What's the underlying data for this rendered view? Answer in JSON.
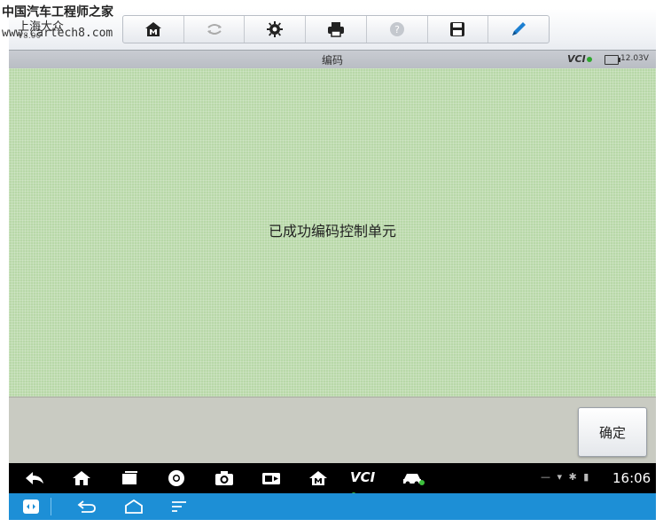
{
  "watermark": {
    "site_name": "中国汽车工程师之家",
    "url": "www.cartech8.com"
  },
  "toolbar": {
    "brand_name": "上海大众",
    "brand_version": "V8.00",
    "buttons": [
      {
        "icon": "home-icon"
      },
      {
        "icon": "vehicle-swap-icon"
      },
      {
        "icon": "gear-icon"
      },
      {
        "icon": "printer-icon"
      },
      {
        "icon": "help-icon"
      },
      {
        "icon": "save-icon"
      },
      {
        "icon": "pen-icon"
      }
    ]
  },
  "titlebar": {
    "title": "编码",
    "vci_label": "VCI",
    "voltage": "12.03V"
  },
  "content": {
    "message": "已成功编码控制单元",
    "background_color": "#b8d8a8"
  },
  "actions": {
    "confirm_label": "确定"
  },
  "statusbar": {
    "icons": [
      "back-icon",
      "home-icon",
      "recent-apps-icon",
      "chrome-icon",
      "camera-icon",
      "screen-capture-icon",
      "maxisys-icon",
      "vci-icon",
      "car-icon"
    ],
    "vci_text": "VCI",
    "time": "16:06"
  },
  "navbar": {
    "background_color": "#1d8fd6",
    "icons": [
      "remote-icon",
      "back-icon",
      "home-icon",
      "menu-icon"
    ]
  }
}
